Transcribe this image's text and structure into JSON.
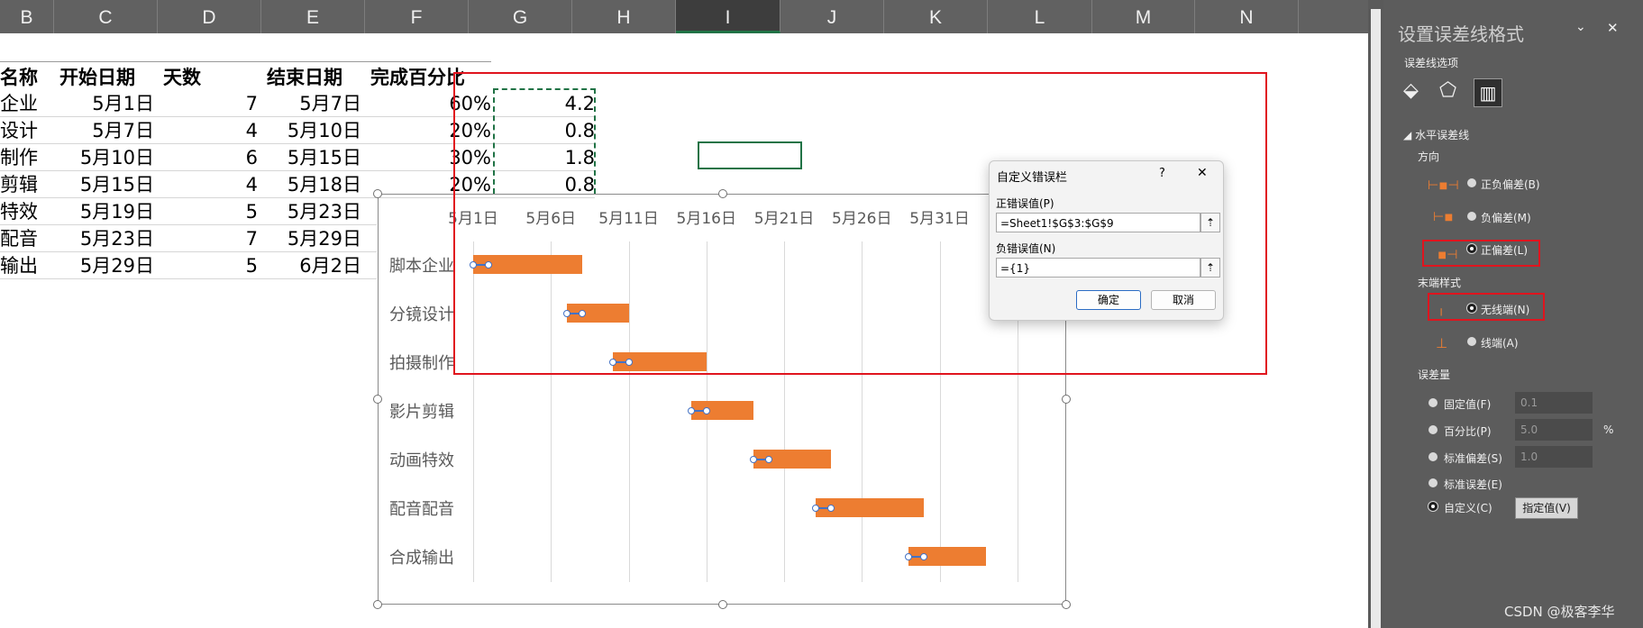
{
  "columns": [
    "B",
    "C",
    "D",
    "E",
    "F",
    "G",
    "H",
    "I",
    "J",
    "K",
    "L",
    "M",
    "N"
  ],
  "selected_column": "I",
  "table": {
    "headers": [
      "名称",
      "开始日期",
      "天数",
      "结束日期",
      "完成百分比"
    ],
    "rows": [
      {
        "name": "企业",
        "start": "5月1日",
        "days": "7",
        "end": "5月7日",
        "pct": "60%",
        "g": "4.2"
      },
      {
        "name": "设计",
        "start": "5月7日",
        "days": "4",
        "end": "5月10日",
        "pct": "20%",
        "g": "0.8"
      },
      {
        "name": "制作",
        "start": "5月10日",
        "days": "6",
        "end": "5月15日",
        "pct": "30%",
        "g": "1.8"
      },
      {
        "name": "剪辑",
        "start": "5月15日",
        "days": "4",
        "end": "5月18日",
        "pct": "20%",
        "g": "0.8"
      },
      {
        "name": "特效",
        "start": "5月19日",
        "days": "5",
        "end": "5月23日",
        "pct": "",
        "g": ""
      },
      {
        "name": "配音",
        "start": "5月23日",
        "days": "7",
        "end": "5月29日",
        "pct": "",
        "g": ""
      },
      {
        "name": "输出",
        "start": "5月29日",
        "days": "5",
        "end": "6月2日",
        "pct": "",
        "g": ""
      }
    ]
  },
  "chart_data": {
    "type": "bar",
    "orientation": "horizontal-gantt",
    "x_tick_labels": [
      "5月1日",
      "5月6日",
      "5月11日",
      "5月16日",
      "5月21日",
      "5月26日",
      "5月31日"
    ],
    "xlim_days": [
      0,
      35
    ],
    "categories": [
      "脚本企业",
      "分镜设计",
      "拍摄制作",
      "影片剪辑",
      "动画特效",
      "配音配音",
      "合成输出"
    ],
    "start_day": [
      0,
      6,
      9,
      14,
      18,
      22,
      28
    ],
    "duration": [
      7,
      4,
      6,
      4,
      5,
      7,
      5
    ],
    "error_plus": [
      1,
      1,
      1,
      1,
      1,
      1,
      1
    ],
    "bar_color": "#ed7d31",
    "error_color": "#4472c4",
    "grid": true
  },
  "dialog": {
    "title": "自定义错误栏",
    "help": "?",
    "close": "✕",
    "positive_label": "正错误值(P)",
    "positive_value": "=Sheet1!$G$3:$G$9",
    "negative_label": "负错误值(N)",
    "negative_value": "={1}",
    "ok": "确定",
    "cancel": "取消"
  },
  "pane": {
    "title": "设置误差线格式",
    "subtitle": "误差线选项",
    "section": "水平误差线",
    "direction_label": "方向",
    "direction_options": [
      "正负偏差(B)",
      "负偏差(M)",
      "正偏差(L)"
    ],
    "end_style_label": "末端样式",
    "end_style_options": [
      "无线端(N)",
      "线端(A)"
    ],
    "amount_label": "误差量",
    "fixed_label": "固定值(F)",
    "fixed_value": "0.1",
    "percent_label": "百分比(P)",
    "percent_value": "5.0",
    "percent_unit": "%",
    "stddev_label": "标准偏差(S)",
    "stddev_value": "1.0",
    "stderr_label": "标准误差(E)",
    "custom_label": "自定义(C)",
    "specify_button": "指定值(V)",
    "watermark": "CSDN @极客李华"
  }
}
